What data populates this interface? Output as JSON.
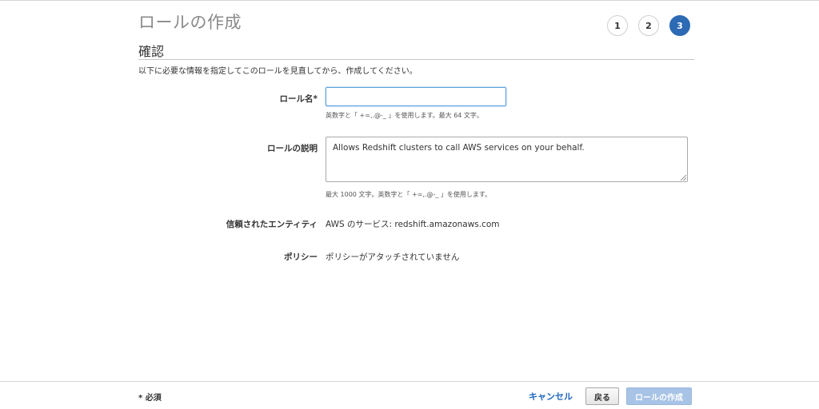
{
  "header": {
    "title": "ロールの作成",
    "steps": [
      "1",
      "2",
      "3"
    ],
    "active_step": 3
  },
  "section": {
    "title": "確認",
    "instructions": "以下に必要な情報を指定してこのロールを見直してから、作成してください。"
  },
  "form": {
    "role_name": {
      "label": "ロール名*",
      "value": "",
      "hint": "英数字と「 +=,.@-_ 」を使用します。最大 64 文字。"
    },
    "role_description": {
      "label": "ロールの説明",
      "value": "Allows Redshift clusters to call AWS services on your behalf.",
      "hint": "最大 1000 文字。英数字と「 +=,.@-_ 」を使用します。"
    },
    "trusted_entity": {
      "label": "信頼されたエンティティ",
      "value": "AWS のサービス: redshift.amazonaws.com"
    },
    "policy": {
      "label": "ポリシー",
      "value": "ポリシーがアタッチされていません"
    }
  },
  "footer": {
    "required_note": "* 必須",
    "cancel_label": "キャンセル",
    "back_label": "戻る",
    "create_label": "ロールの作成"
  },
  "colors": {
    "accent": "#2d6ab4",
    "link": "#1d66bd",
    "create_button_disabled": "#a7c3e5"
  }
}
